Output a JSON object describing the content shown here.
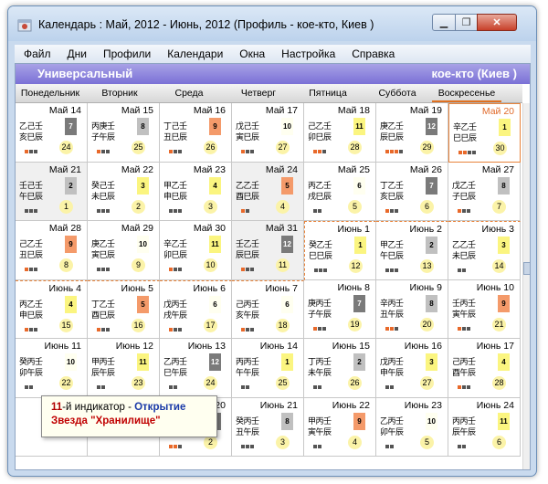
{
  "window": {
    "title": "Календарь : Май, 2012 - Июнь, 2012 (Профиль - кое-кто, Киев )",
    "min_glyph": "▁",
    "max_glyph": "❐",
    "close_glyph": "✕"
  },
  "menu": [
    "Файл",
    "Дни",
    "Профили",
    "Календари",
    "Окна",
    "Настройка",
    "Справка"
  ],
  "profile_bar": {
    "left": "Универсальный",
    "right": "кое-кто (Киев )"
  },
  "weekdays": [
    "Понедельник",
    "Вторник",
    "Среда",
    "Четверг",
    "Пятница",
    "Суббота",
    "Воскресенье"
  ],
  "colors": {
    "gray_dark": "#7a7a7a",
    "gray_light": "#c0c0c0",
    "orange": "#f49a6a",
    "yellow": "#fbf580",
    "pale": "#fffff0",
    "dot_orange": "#e8692a",
    "dot_gray": "#555555"
  },
  "cells": [
    {
      "date": "Май 14",
      "h1": "乙己壬",
      "h2": "亥巳辰",
      "ind": "7",
      "indc": "gray_dark",
      "moon": "24",
      "dots": [
        "o",
        "g",
        "g"
      ]
    },
    {
      "date": "Май 15",
      "h1": "丙庚壬",
      "h2": "子午辰",
      "ind": "8",
      "indc": "gray_light",
      "moon": "25",
      "dots": [
        "o",
        "g",
        "g"
      ]
    },
    {
      "date": "Май 16",
      "h1": "丁己壬",
      "h2": "丑巳辰",
      "ind": "9",
      "indc": "orange",
      "moon": "26",
      "dots": [
        "o",
        "g",
        "g"
      ]
    },
    {
      "date": "Май 17",
      "h1": "戊己壬",
      "h2": "寅巳辰",
      "ind": "10",
      "indc": "pale",
      "moon": "27",
      "dots": [
        "o",
        "g",
        "g"
      ]
    },
    {
      "date": "Май 18",
      "h1": "己乙壬",
      "h2": "卯巳辰",
      "ind": "11",
      "indc": "yellow",
      "moon": "28",
      "dots": [
        "o",
        "o",
        "g"
      ]
    },
    {
      "date": "Май 19",
      "h1": "庚乙壬",
      "h2": "辰巳辰",
      "ind": "12",
      "indc": "gray_dark",
      "moon": "29",
      "dots": [
        "o",
        "o",
        "o",
        "g"
      ]
    },
    {
      "date": "Май 20",
      "h1": "辛乙壬",
      "h2": "巳巳辰",
      "ind": "1",
      "indc": "yellow",
      "moon": "30",
      "dots": [
        "o",
        "o",
        "g",
        "g"
      ],
      "red": true,
      "selected": true
    },
    {
      "date": "Май 21",
      "h1": "壬己壬",
      "h2": "午巳辰",
      "ind": "2",
      "indc": "gray_light",
      "moon": "1",
      "dots": [
        "g",
        "g",
        "g"
      ],
      "shaded": true
    },
    {
      "date": "Май 22",
      "h1": "癸己壬",
      "h2": "未巳辰",
      "ind": "3",
      "indc": "yellow",
      "moon": "2",
      "dots": [
        "g",
        "g",
        "g"
      ]
    },
    {
      "date": "Май 23",
      "h1": "甲乙壬",
      "h2": "申巳辰",
      "ind": "4",
      "indc": "yellow",
      "moon": "3",
      "dots": [
        "g",
        "g",
        "g"
      ]
    },
    {
      "date": "Май 24",
      "h1": "乙乙壬",
      "h2": "酉巳辰",
      "ind": "5",
      "indc": "orange",
      "moon": "4",
      "dots": [
        "o",
        "g"
      ],
      "shaded": true
    },
    {
      "date": "Май 25",
      "h1": "丙乙壬",
      "h2": "戌巳辰",
      "ind": "6",
      "indc": "pale",
      "moon": "5",
      "dots": [
        "g",
        "g"
      ]
    },
    {
      "date": "Май 26",
      "h1": "丁乙壬",
      "h2": "亥巳辰",
      "ind": "7",
      "indc": "gray_dark",
      "moon": "6",
      "dots": [
        "o",
        "g",
        "g"
      ]
    },
    {
      "date": "Май 27",
      "h1": "戊乙壬",
      "h2": "子巳辰",
      "ind": "8",
      "indc": "gray_light",
      "moon": "7",
      "dots": [
        "o",
        "g",
        "g"
      ]
    },
    {
      "date": "Май 28",
      "h1": "己乙壬",
      "h2": "丑巳辰",
      "ind": "9",
      "indc": "orange",
      "moon": "8",
      "dots": [
        "o",
        "g",
        "g"
      ]
    },
    {
      "date": "Май 29",
      "h1": "庚乙壬",
      "h2": "寅巳辰",
      "ind": "10",
      "indc": "pale",
      "moon": "9",
      "dots": [
        "g",
        "g",
        "g"
      ]
    },
    {
      "date": "Май 30",
      "h1": "辛乙壬",
      "h2": "卯巳辰",
      "ind": "11",
      "indc": "yellow",
      "moon": "10",
      "dots": [
        "o",
        "g",
        "g"
      ]
    },
    {
      "date": "Май 31",
      "h1": "壬乙壬",
      "h2": "辰巳辰",
      "ind": "12",
      "indc": "gray_dark",
      "moon": "11",
      "dots": [
        "o",
        "g",
        "g"
      ],
      "shaded": true
    },
    {
      "date": "Июнь 1",
      "h1": "癸乙壬",
      "h2": "巳巳辰",
      "ind": "1",
      "indc": "yellow",
      "moon": "12",
      "dots": [
        "g",
        "g",
        "g"
      ],
      "dashed_top": true,
      "dashed_left": true
    },
    {
      "date": "Июнь 2",
      "h1": "甲乙壬",
      "h2": "午巳辰",
      "ind": "2",
      "indc": "gray_light",
      "moon": "13",
      "dots": [
        "g",
        "g",
        "g"
      ],
      "dashed_top": true
    },
    {
      "date": "Июнь 3",
      "h1": "乙乙壬",
      "h2": "未巳辰",
      "ind": "3",
      "indc": "yellow",
      "moon": "14",
      "dots": [
        "g",
        "g"
      ],
      "dashed_top": true
    },
    {
      "date": "Июнь 4",
      "h1": "丙乙壬",
      "h2": "申巳辰",
      "ind": "4",
      "indc": "yellow",
      "moon": "15",
      "dots": [
        "o",
        "g",
        "g"
      ],
      "dashed_top": true
    },
    {
      "date": "Июнь 5",
      "h1": "丁乙壬",
      "h2": "酉巳辰",
      "ind": "5",
      "indc": "orange",
      "moon": "16",
      "dots": [
        "o",
        "g",
        "g"
      ],
      "dashed_top": true
    },
    {
      "date": "Июнь 6",
      "h1": "戊丙壬",
      "h2": "戌午辰",
      "ind": "6",
      "indc": "pale",
      "moon": "17",
      "dots": [
        "o",
        "g",
        "g"
      ],
      "dashed_top": true
    },
    {
      "date": "Июнь 7",
      "h1": "己丙壬",
      "h2": "亥午辰",
      "ind": "6",
      "indc": "pale",
      "moon": "18",
      "dots": [
        "o",
        "g",
        "g"
      ],
      "dashed_top": true
    },
    {
      "date": "Июнь 8",
      "h1": "庚丙壬",
      "h2": "子午辰",
      "ind": "7",
      "indc": "gray_dark",
      "moon": "19",
      "dots": [
        "o",
        "g",
        "g"
      ]
    },
    {
      "date": "Июнь 9",
      "h1": "辛丙壬",
      "h2": "丑午辰",
      "ind": "8",
      "indc": "gray_light",
      "moon": "20",
      "dots": [
        "o",
        "o",
        "g"
      ]
    },
    {
      "date": "Июнь 10",
      "h1": "壬丙壬",
      "h2": "寅午辰",
      "ind": "9",
      "indc": "orange",
      "moon": "21",
      "dots": [
        "o",
        "g",
        "g"
      ]
    },
    {
      "date": "Июнь 11",
      "h1": "癸丙壬",
      "h2": "卯午辰",
      "ind": "10",
      "indc": "pale",
      "moon": "22",
      "dots": [
        "g",
        "g"
      ]
    },
    {
      "date": "Июнь 12",
      "h1": "甲丙壬",
      "h2": "辰午辰",
      "ind": "11",
      "indc": "yellow",
      "moon": "23",
      "dots": [
        "g",
        "g"
      ]
    },
    {
      "date": "Июнь 13",
      "h1": "乙丙壬",
      "h2": "巳午辰",
      "ind": "12",
      "indc": "gray_dark",
      "moon": "24",
      "dots": [
        "g",
        "g"
      ]
    },
    {
      "date": "Июнь 14",
      "h1": "丙丙壬",
      "h2": "午午辰",
      "ind": "1",
      "indc": "yellow",
      "moon": "25",
      "dots": [
        "g",
        "g"
      ]
    },
    {
      "date": "Июнь 15",
      "h1": "丁丙壬",
      "h2": "未午辰",
      "ind": "2",
      "indc": "gray_light",
      "moon": "26",
      "dots": [
        "g",
        "g"
      ]
    },
    {
      "date": "Июнь 16",
      "h1": "戊丙壬",
      "h2": "申午辰",
      "ind": "3",
      "indc": "yellow",
      "moon": "27",
      "dots": [
        "g",
        "g"
      ]
    },
    {
      "date": "Июнь 17",
      "h1": "己丙壬",
      "h2": "酉午辰",
      "ind": "4",
      "indc": "yellow",
      "moon": "28",
      "dots": [
        "o",
        "g",
        "g"
      ]
    },
    {
      "date": "",
      "h1": "",
      "h2": "",
      "ind": "",
      "indc": "pale",
      "moon": "",
      "dots": []
    },
    {
      "date": "",
      "h1": "",
      "h2": "",
      "ind": "",
      "indc": "pale",
      "moon": "",
      "dots": []
    },
    {
      "date": "Июнь 20",
      "h1": "壬丙壬",
      "h2": "子午辰",
      "ind": "7",
      "indc": "gray_dark",
      "moon": "2",
      "dots": [
        "o",
        "o",
        "g"
      ]
    },
    {
      "date": "Июнь 21",
      "h1": "癸丙壬",
      "h2": "丑午辰",
      "ind": "8",
      "indc": "gray_light",
      "moon": "3",
      "dots": [
        "g",
        "g",
        "g"
      ]
    },
    {
      "date": "Июнь 22",
      "h1": "甲丙壬",
      "h2": "寅午辰",
      "ind": "9",
      "indc": "orange",
      "moon": "4",
      "dots": [
        "g",
        "g"
      ]
    },
    {
      "date": "Июнь 23",
      "h1": "乙丙壬",
      "h2": "卯午辰",
      "ind": "10",
      "indc": "pale",
      "moon": "5",
      "dots": [
        "g",
        "g"
      ]
    },
    {
      "date": "Июнь 24",
      "h1": "丙丙壬",
      "h2": "辰午辰",
      "ind": "11",
      "indc": "yellow",
      "moon": "6",
      "dots": [
        "g",
        "g"
      ]
    }
  ],
  "tooltip": {
    "num": "11",
    "suffix": "-й индикатор - ",
    "blue": "Открытие",
    "red": "Звезда \"Хранилище\""
  }
}
